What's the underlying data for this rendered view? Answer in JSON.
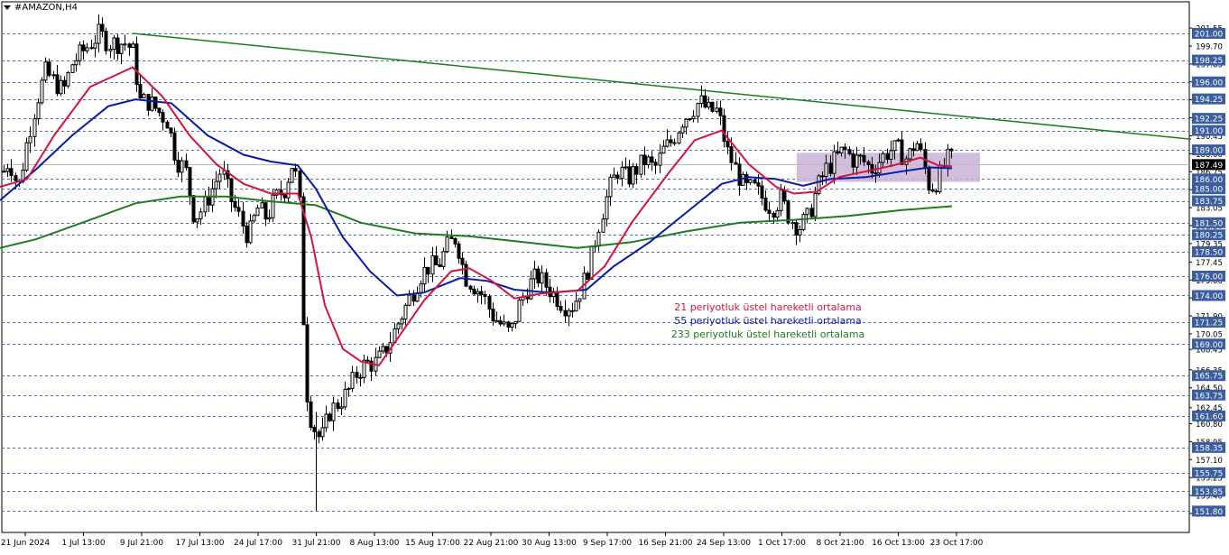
{
  "window": {
    "title": "#AMAZON,H4"
  },
  "colors": {
    "background": "#ffffff",
    "grid_dashed": "#4a6ea8",
    "ema21": "#d4143c",
    "ema55": "#0a1aa8",
    "ema233": "#1e7d1e",
    "trendline": "#1e7d1e",
    "zone": "#cbb1d6",
    "candle": "#000000",
    "price_box": "#3a5ea0",
    "current_price_box": "#000000"
  },
  "chart_data": {
    "type": "candlestick",
    "symbol": "#AMAZON",
    "timeframe": "H4",
    "ylim": [
      150.9,
      202.3
    ],
    "x_ticks": [
      "21 Jun 2024",
      "1 Jul 13:00",
      "9 Jul 21:00",
      "17 Jul 13:00",
      "24 Jul 17:00",
      "31 Jul 21:00",
      "8 Aug 13:00",
      "15 Aug 17:00",
      "22 Aug 21:00",
      "30 Aug 13:00",
      "9 Sep 17:00",
      "16 Sep 21:00",
      "24 Sep 13:00",
      "1 Oct 17:00",
      "8 Oct 21:00",
      "16 Oct 13:00",
      "23 Oct 17:00"
    ],
    "level_labels": [
      "201.00",
      "198.25",
      "196.00",
      "194.25",
      "192.25",
      "191.00",
      "189.00",
      "187.49",
      "186.00",
      "185.00",
      "183.75",
      "181.50",
      "180.25",
      "178.50",
      "176.00",
      "174.00",
      "171.25",
      "169.00",
      "165.75",
      "163.75",
      "161.60",
      "158.35",
      "155.75",
      "153.85",
      "151.80"
    ],
    "axis_labels": [
      "201.55",
      "199.70",
      "197.85",
      "196.00",
      "194.15",
      "192.30",
      "190.45",
      "188.60",
      "186.75",
      "184.90",
      "183.05",
      "181.20",
      "179.35",
      "177.45",
      "175.60",
      "173.75",
      "171.90",
      "170.05",
      "168.45",
      "166.35",
      "164.50",
      "162.45",
      "160.80",
      "158.95",
      "157.10",
      "155.25",
      "153.40",
      "151.55"
    ],
    "current_price": "187.49",
    "legend": [
      {
        "name": "21 periyotluk üstel hareketli ortalama",
        "color": "#d4143c"
      },
      {
        "name": "55 periyotluk üstel hareketli ortalama",
        "color": "#0a1aa8"
      },
      {
        "name": "233 periyotluk üstel hareketli ortalama",
        "color": "#1e7d1e"
      }
    ],
    "trendline": {
      "from": [
        147,
        201.0
      ],
      "to": [
        1320,
        190.1
      ]
    },
    "zone": {
      "x_from": 883,
      "x_to": 1086,
      "y_top": 188.7,
      "y_bottom": 185.7
    },
    "anchors": [
      [
        0,
        186
      ],
      [
        10,
        188
      ],
      [
        20,
        185
      ],
      [
        30,
        190
      ],
      [
        40,
        194
      ],
      [
        50,
        197
      ],
      [
        60,
        196
      ],
      [
        70,
        195
      ],
      [
        80,
        198
      ],
      [
        90,
        199
      ],
      [
        100,
        200
      ],
      [
        110,
        201
      ],
      [
        120,
        200
      ],
      [
        130,
        200
      ],
      [
        140,
        200
      ],
      [
        147,
        199
      ],
      [
        155,
        194
      ],
      [
        165,
        194
      ],
      [
        175,
        193
      ],
      [
        185,
        192
      ],
      [
        195,
        188
      ],
      [
        205,
        187
      ],
      [
        215,
        182
      ],
      [
        225,
        183
      ],
      [
        235,
        185
      ],
      [
        245,
        187
      ],
      [
        255,
        184
      ],
      [
        265,
        182
      ],
      [
        275,
        180
      ],
      [
        285,
        183
      ],
      [
        295,
        182
      ],
      [
        305,
        184
      ],
      [
        315,
        185
      ],
      [
        325,
        188
      ],
      [
        332,
        183
      ],
      [
        338,
        165
      ],
      [
        345,
        161
      ],
      [
        355,
        159
      ],
      [
        365,
        162
      ],
      [
        375,
        163
      ],
      [
        385,
        164
      ],
      [
        395,
        166
      ],
      [
        405,
        167
      ],
      [
        415,
        167
      ],
      [
        425,
        168
      ],
      [
        435,
        170
      ],
      [
        445,
        172
      ],
      [
        455,
        174
      ],
      [
        465,
        176
      ],
      [
        475,
        177
      ],
      [
        485,
        177
      ],
      [
        495,
        179
      ],
      [
        505,
        180
      ],
      [
        515,
        176
      ],
      [
        525,
        175
      ],
      [
        535,
        174
      ],
      [
        545,
        172
      ],
      [
        555,
        171
      ],
      [
        565,
        170
      ],
      [
        575,
        173
      ],
      [
        585,
        175
      ],
      [
        595,
        176
      ],
      [
        605,
        175
      ],
      [
        615,
        174
      ],
      [
        625,
        173
      ],
      [
        635,
        173
      ],
      [
        645,
        175
      ],
      [
        655,
        178
      ],
      [
        665,
        182
      ],
      [
        675,
        185
      ],
      [
        685,
        187
      ],
      [
        695,
        186
      ],
      [
        705,
        187
      ],
      [
        715,
        188
      ],
      [
        725,
        187
      ],
      [
        735,
        189
      ],
      [
        745,
        190
      ],
      [
        755,
        192
      ],
      [
        765,
        193
      ],
      [
        775,
        194
      ],
      [
        785,
        193
      ],
      [
        795,
        193
      ],
      [
        805,
        189
      ],
      [
        815,
        187
      ],
      [
        825,
        185
      ],
      [
        835,
        185
      ],
      [
        845,
        184
      ],
      [
        855,
        183
      ],
      [
        865,
        184
      ],
      [
        875,
        182
      ],
      [
        885,
        181
      ],
      [
        895,
        182
      ],
      [
        905,
        185
      ],
      [
        915,
        187
      ],
      [
        925,
        188
      ],
      [
        935,
        189
      ],
      [
        945,
        188
      ],
      [
        955,
        188
      ],
      [
        965,
        187
      ],
      [
        975,
        188
      ],
      [
        985,
        189
      ],
      [
        995,
        189
      ],
      [
        1005,
        188
      ],
      [
        1015,
        190
      ],
      [
        1022,
        188
      ],
      [
        1030,
        185
      ],
      [
        1040,
        186
      ],
      [
        1048,
        188
      ],
      [
        1055,
        188
      ]
    ],
    "ema21_points": [
      [
        0,
        185.2
      ],
      [
        30,
        186
      ],
      [
        60,
        190.5
      ],
      [
        100,
        195.5
      ],
      [
        147,
        197.5
      ],
      [
        180,
        194.5
      ],
      [
        210,
        190.5
      ],
      [
        240,
        187.5
      ],
      [
        270,
        185.5
      ],
      [
        300,
        184.5
      ],
      [
        330,
        184.5
      ],
      [
        345,
        180
      ],
      [
        360,
        173
      ],
      [
        380,
        168.5
      ],
      [
        400,
        167.2
      ],
      [
        420,
        166.8
      ],
      [
        440,
        169.5
      ],
      [
        470,
        173.5
      ],
      [
        500,
        176.5
      ],
      [
        520,
        176.8
      ],
      [
        545,
        175.5
      ],
      [
        570,
        173.7
      ],
      [
        600,
        174.2
      ],
      [
        640,
        174.5
      ],
      [
        670,
        177
      ],
      [
        700,
        181.5
      ],
      [
        740,
        186.5
      ],
      [
        770,
        190
      ],
      [
        800,
        191
      ],
      [
        830,
        187.5
      ],
      [
        860,
        185.2
      ],
      [
        880,
        184.5
      ],
      [
        905,
        184.7
      ],
      [
        930,
        186.2
      ],
      [
        960,
        186.8
      ],
      [
        990,
        187.4
      ],
      [
        1020,
        188.2
      ],
      [
        1040,
        187.4
      ],
      [
        1055,
        187.3
      ]
    ],
    "ema55_points": [
      [
        0,
        183.8
      ],
      [
        40,
        187
      ],
      [
        80,
        190.5
      ],
      [
        120,
        193.5
      ],
      [
        150,
        194.2
      ],
      [
        190,
        193.8
      ],
      [
        230,
        190.5
      ],
      [
        270,
        188.5
      ],
      [
        300,
        187.8
      ],
      [
        330,
        187.4
      ],
      [
        350,
        185
      ],
      [
        380,
        180
      ],
      [
        410,
        176.5
      ],
      [
        440,
        174
      ],
      [
        470,
        174.3
      ],
      [
        510,
        175.8
      ],
      [
        540,
        175.5
      ],
      [
        570,
        174.6
      ],
      [
        610,
        174.3
      ],
      [
        650,
        174.6
      ],
      [
        680,
        177
      ],
      [
        720,
        179.5
      ],
      [
        760,
        182.5
      ],
      [
        800,
        185.5
      ],
      [
        830,
        186.2
      ],
      [
        860,
        186
      ],
      [
        890,
        185.3
      ],
      [
        920,
        186
      ],
      [
        960,
        186.2
      ],
      [
        1000,
        186.8
      ],
      [
        1030,
        187.2
      ],
      [
        1055,
        187.1
      ]
    ],
    "ema233_points": [
      [
        0,
        178.9
      ],
      [
        40,
        179.8
      ],
      [
        100,
        181.8
      ],
      [
        150,
        183.5
      ],
      [
        200,
        184.2
      ],
      [
        250,
        184.2
      ],
      [
        300,
        183.7
      ],
      [
        350,
        183.3
      ],
      [
        400,
        181.5
      ],
      [
        460,
        180.4
      ],
      [
        520,
        180.1
      ],
      [
        580,
        179.5
      ],
      [
        640,
        178.9
      ],
      [
        700,
        179.5
      ],
      [
        760,
        180.6
      ],
      [
        820,
        181.5
      ],
      [
        880,
        181.8
      ],
      [
        940,
        182.2
      ],
      [
        1000,
        182.8
      ],
      [
        1055,
        183.2
      ]
    ]
  }
}
